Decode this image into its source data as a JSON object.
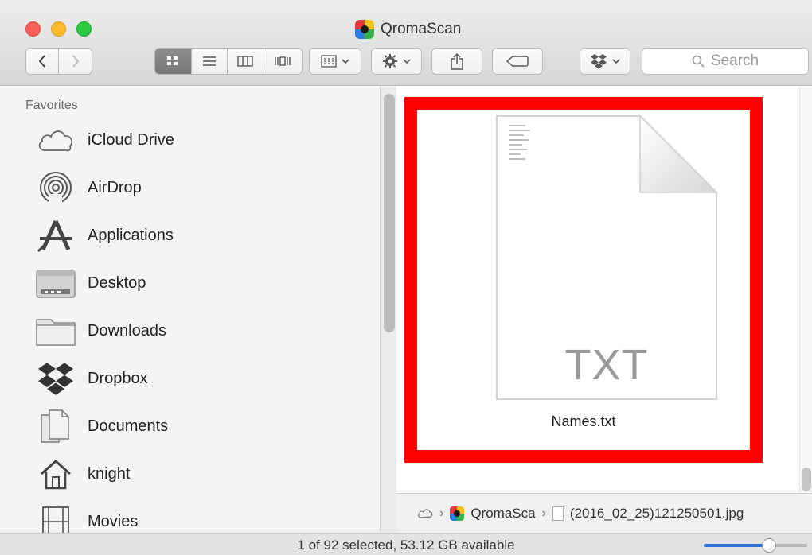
{
  "window": {
    "title": "QromaScan"
  },
  "toolbar": {
    "back": "<",
    "forward": ">",
    "search_placeholder": "Search",
    "search_icon": "search-icon",
    "view_modes": [
      "icon-view-icon",
      "list-view-icon",
      "column-view-icon",
      "cover-flow-icon"
    ],
    "arrange_icon": "arrange-icon",
    "action_icon": "gear-icon",
    "share_icon": "share-icon",
    "tag_icon": "tag-icon",
    "dropbox_icon": "dropbox-icon"
  },
  "sidebar": {
    "section": "Favorites",
    "items": [
      {
        "label": "iCloud Drive",
        "icon": "cloud-icon"
      },
      {
        "label": "AirDrop",
        "icon": "airdrop-icon"
      },
      {
        "label": "Applications",
        "icon": "applications-icon"
      },
      {
        "label": "Desktop",
        "icon": "desktop-folder-icon"
      },
      {
        "label": "Downloads",
        "icon": "downloads-folder-icon"
      },
      {
        "label": "Dropbox",
        "icon": "dropbox-icon"
      },
      {
        "label": "Documents",
        "icon": "documents-icon"
      },
      {
        "label": "knight",
        "icon": "home-icon"
      },
      {
        "label": "Movies",
        "icon": "movies-icon"
      }
    ]
  },
  "content": {
    "selected_file": {
      "name": "Names.txt",
      "type_label": "TXT"
    }
  },
  "pathbar": {
    "items": [
      "QromaScan",
      "(2016_02_25)121250501.jpg"
    ],
    "display_first": "QromaSca"
  },
  "statusbar": {
    "text": "1 of 92 selected, 53.12 GB available",
    "icon_size_fraction": 0.65
  },
  "colors": {
    "highlight_frame": "#ff0000",
    "accent": "#2a71d8"
  }
}
